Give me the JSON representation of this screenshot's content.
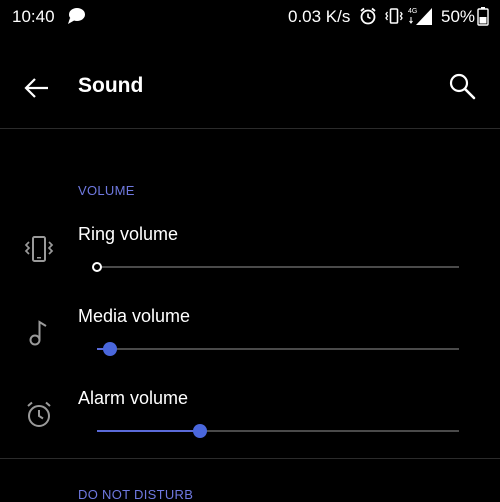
{
  "status_bar": {
    "time": "10:40",
    "net_speed": "0.03 K/s",
    "network_type": "4G",
    "battery": "50%"
  },
  "app_bar": {
    "title": "Sound"
  },
  "sections": [
    {
      "header": "VOLUME",
      "rows": [
        {
          "label": "Ring volume",
          "icon": "vibrate-icon",
          "level": 0.0
        },
        {
          "label": "Media volume",
          "icon": "music-note-icon",
          "level": 0.035
        },
        {
          "label": "Alarm volume",
          "icon": "alarm-icon",
          "level": 0.285
        }
      ]
    },
    {
      "header": "DO NOT DISTURB"
    }
  ],
  "colors": {
    "accent": "#5a6ad8",
    "background": "#000000",
    "track": "#4a4a4a"
  }
}
